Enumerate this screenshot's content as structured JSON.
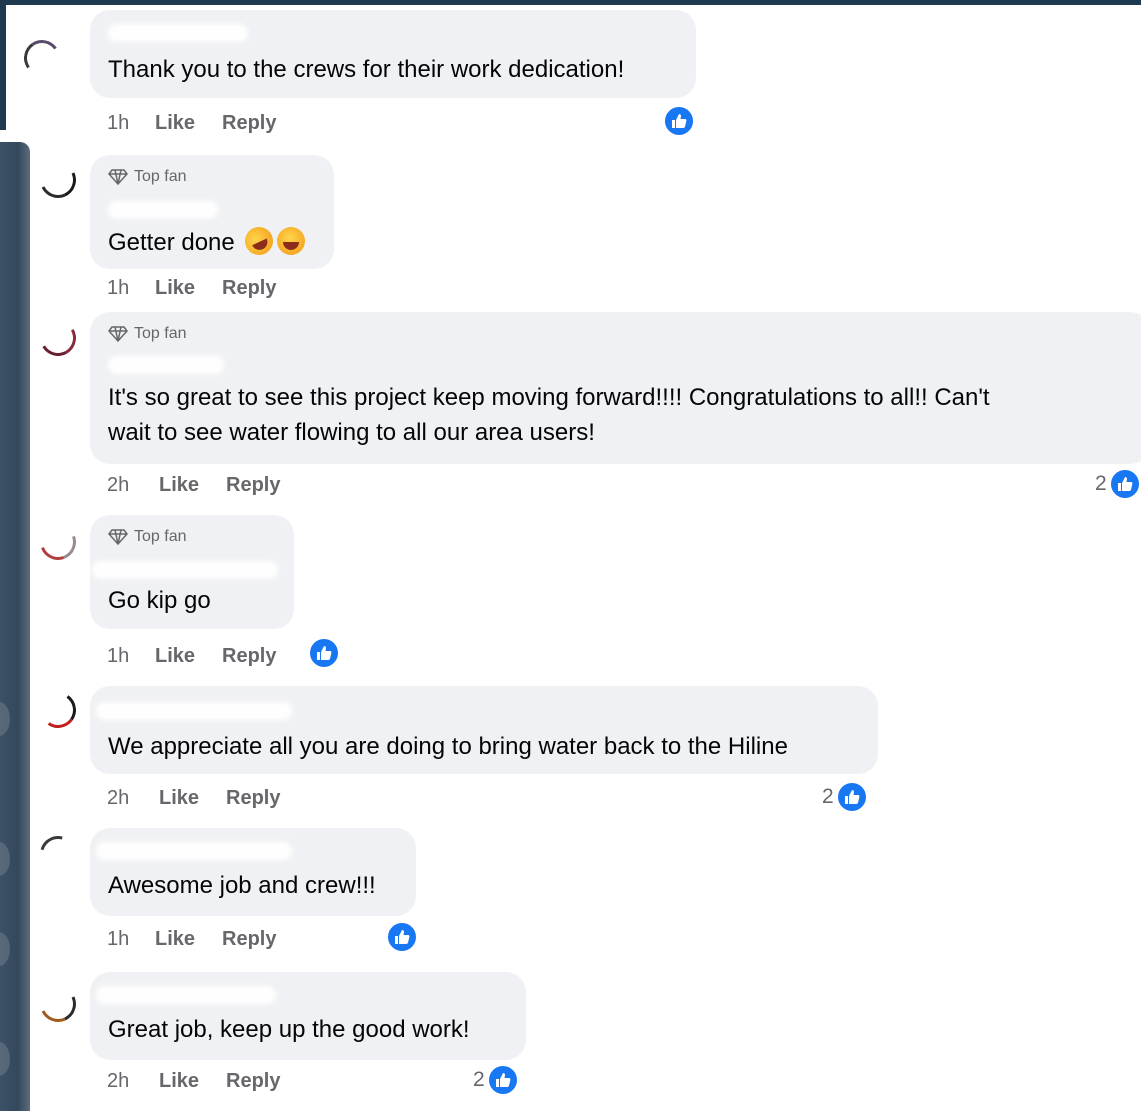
{
  "actions": {
    "like_label": "Like",
    "reply_label": "Reply"
  },
  "badge": {
    "top_fan_label": "Top fan",
    "icon": "diamond-icon"
  },
  "reaction_icon": "thumbs-up-icon",
  "colors": {
    "bubble": "#eff1f4",
    "like_blue": "#1877f2",
    "meta_gray": "#65676b",
    "side_panel": "#34485d"
  },
  "comments": [
    {
      "text": "Thank you to the crews for their work dedication!",
      "time": "1h",
      "top_fan": false,
      "reaction_count": ""
    },
    {
      "text": "Getter done",
      "emojis": [
        "rolling-on-floor-laughing-emoji",
        "tears-of-joy-emoji"
      ],
      "time": "1h",
      "top_fan": true,
      "reaction_count": ""
    },
    {
      "text_lines": [
        "It's so great to see this project keep moving forward!!!! Congratulations to all!! Can't",
        "wait to see water flowing to all our area users!"
      ],
      "time": "2h",
      "top_fan": true,
      "reaction_count": "2"
    },
    {
      "text": "Go kip go",
      "time": "1h",
      "top_fan": true,
      "reaction_count": ""
    },
    {
      "text": "We appreciate all you are doing to bring water back to the Hiline",
      "time": "2h",
      "top_fan": false,
      "reaction_count": "2"
    },
    {
      "text": "Awesome job and crew!!!",
      "time": "1h",
      "top_fan": false,
      "reaction_count": ""
    },
    {
      "text": "Great job, keep up the good work!",
      "time": "2h",
      "top_fan": false,
      "reaction_count": "2"
    }
  ]
}
